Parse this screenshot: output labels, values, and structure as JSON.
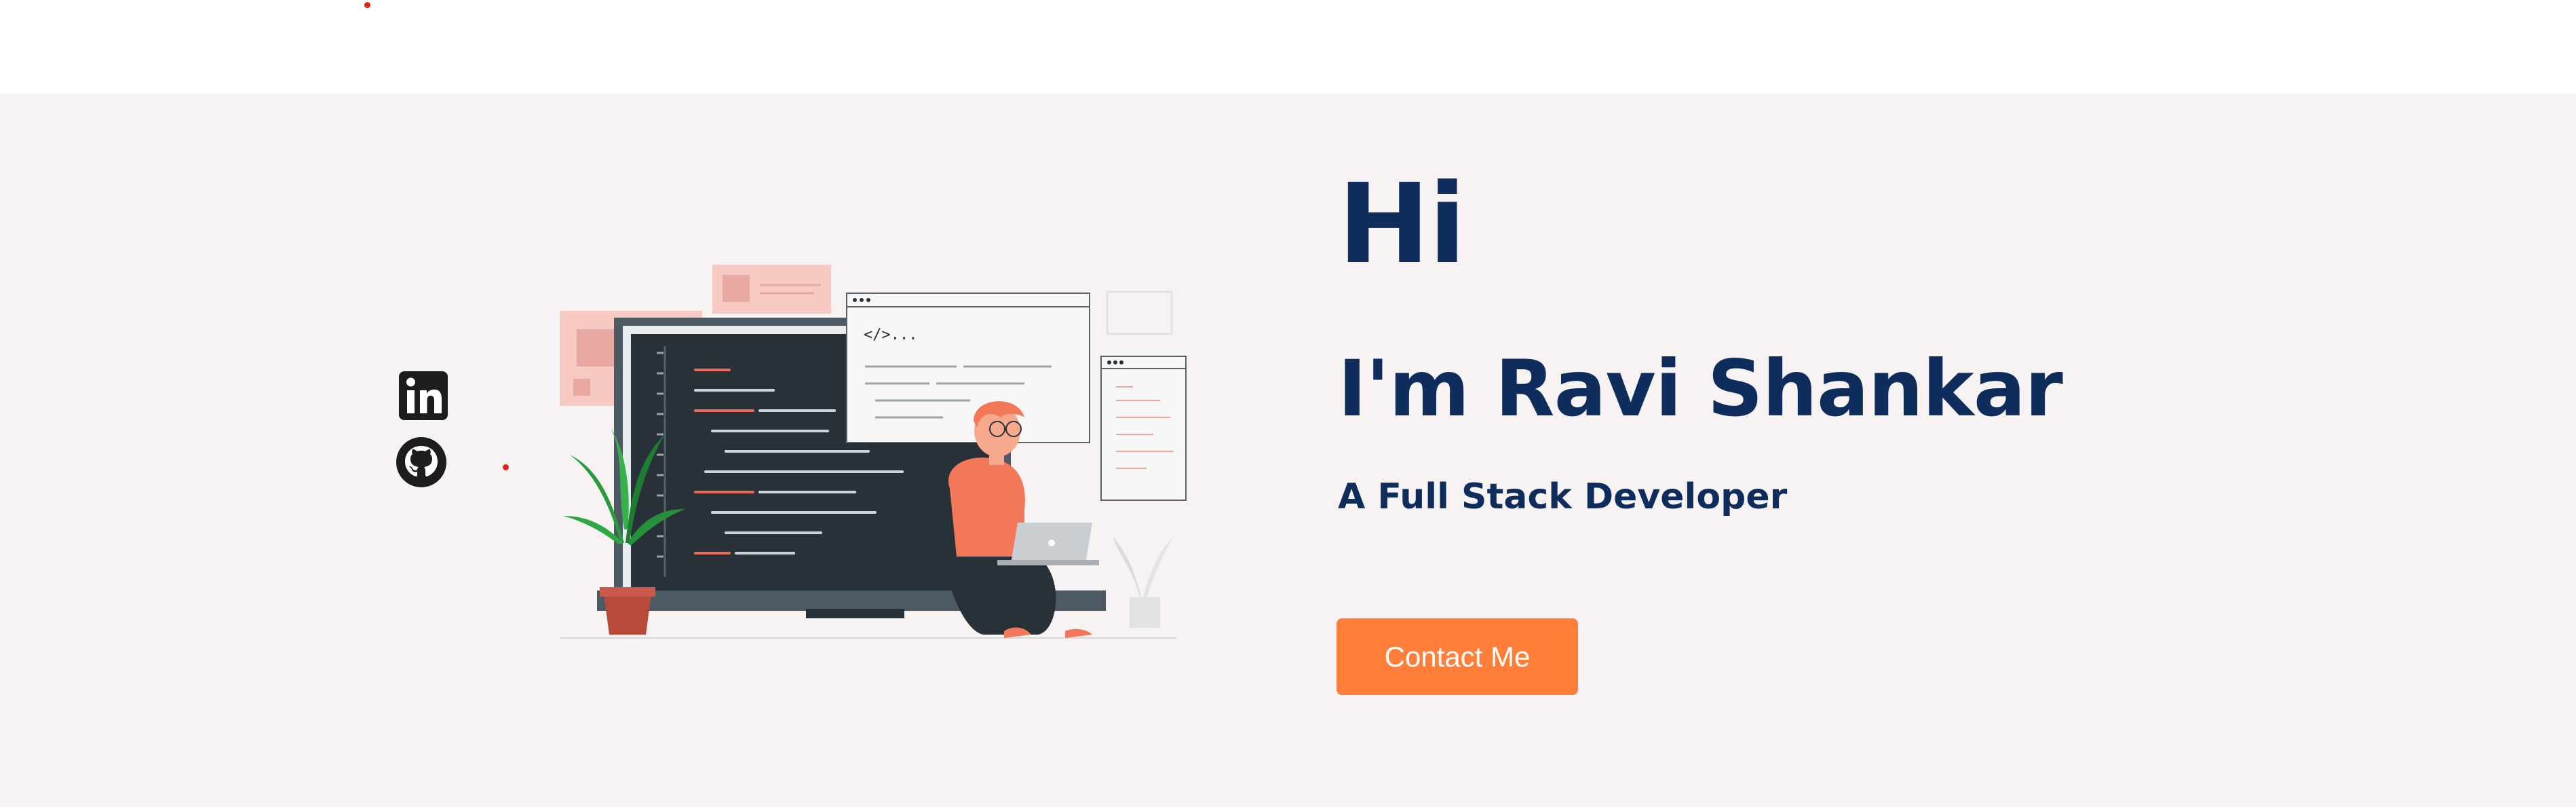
{
  "hero": {
    "greeting": "Hi",
    "name": "I'm Ravi Shankar",
    "role": "A Full Stack Developer",
    "contact_label": "Contact Me",
    "illustration_code_text": "</>..."
  },
  "social": {
    "linkedin_icon": "linkedin-icon",
    "github_icon": "github-icon"
  },
  "colors": {
    "accent": "#ff7f3a",
    "heading": "#0f2d5c",
    "hero_background": "#f7f3f3"
  }
}
